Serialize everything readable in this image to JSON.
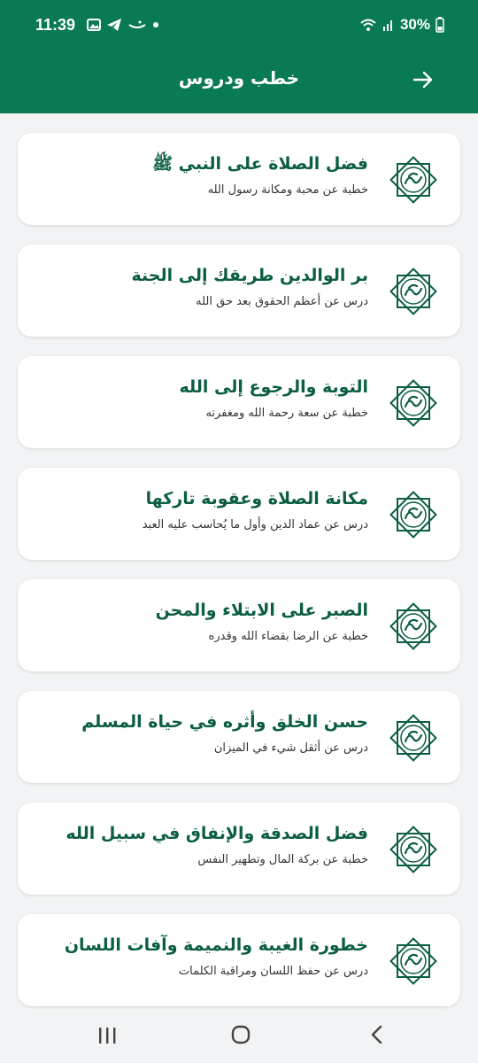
{
  "status": {
    "time": "11:39",
    "battery": "30%"
  },
  "header": {
    "title": "خطب ودروس"
  },
  "items": [
    {
      "title": "فضل الصلاة على النبي ﷺ",
      "subtitle": "خطبة عن محبة ومكانة رسول الله"
    },
    {
      "title": "بر الوالدين طريقك إلى الجنة",
      "subtitle": "درس عن أعظم الحقوق بعد حق الله"
    },
    {
      "title": "التوبة والرجوع إلى الله",
      "subtitle": "خطبة عن سعة رحمة الله ومغفرته"
    },
    {
      "title": "مكانة الصلاة وعقوبة تاركها",
      "subtitle": "درس عن عماد الدين وأول ما يُحاسب عليه العبد"
    },
    {
      "title": "الصبر على الابتلاء والمحن",
      "subtitle": "خطبة عن الرضا بقضاء الله وقدره"
    },
    {
      "title": "حسن الخلق وأثره في حياة المسلم",
      "subtitle": "درس عن أثقل شيء في الميزان"
    },
    {
      "title": "فضل الصدقة والإنفاق في سبيل الله",
      "subtitle": "خطبة عن بركة المال وتطهير النفس"
    },
    {
      "title": "خطورة الغيبة والنميمة وآفات اللسان",
      "subtitle": "درس عن حفظ اللسان ومراقبة الكلمات"
    }
  ],
  "icons": {
    "item": "muhammad-calligraphy-icon",
    "back": "arrow-right-icon"
  },
  "colors": {
    "primary": "#0a7a55",
    "title_text": "#0b5e41"
  }
}
